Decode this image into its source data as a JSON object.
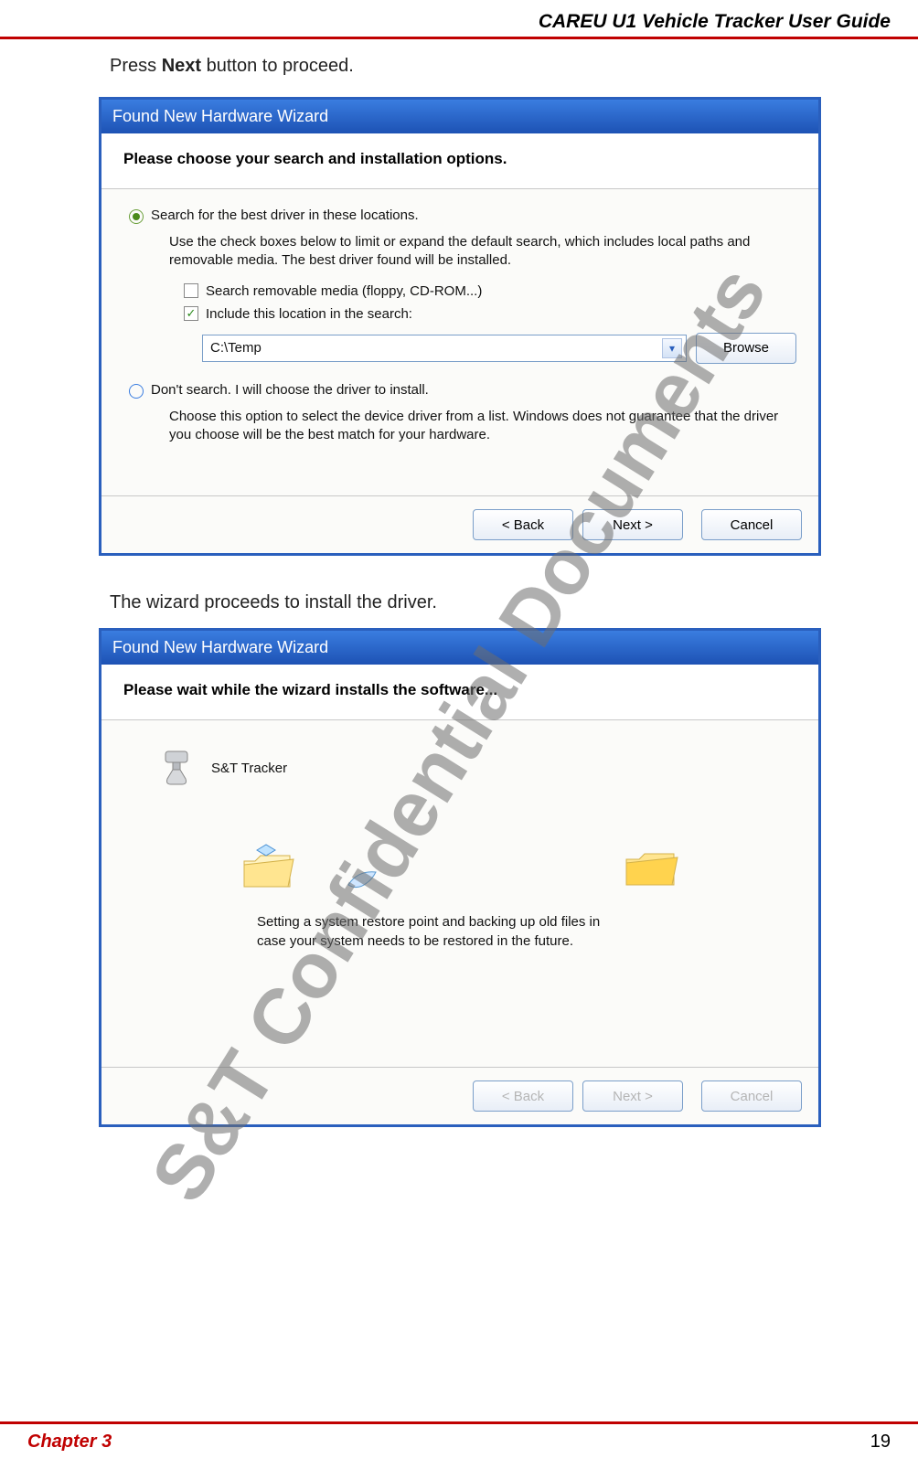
{
  "doc": {
    "header_title": "CAREU U1 Vehicle Tracker User Guide",
    "instruction_prefix": "Press ",
    "instruction_bold": "Next",
    "instruction_suffix": " button to proceed.",
    "instruction2": "The wizard proceeds to install the driver.",
    "chapter": "Chapter 3",
    "page": "19",
    "watermark": "S&T Confidential Documents"
  },
  "wizard1": {
    "title": "Found New Hardware Wizard",
    "subtitle": "Please choose your search and installation options.",
    "opt1_label": "Search for the best driver in these locations.",
    "opt1_explain": "Use the check boxes below to limit or expand the default search, which includes local paths and removable media. The best driver found will be installed.",
    "cb1_label": "Search removable media (floppy, CD-ROM...)",
    "cb2_label": "Include this location in the search:",
    "path_value": "C:\\Temp",
    "browse": "Browse",
    "opt2_label": "Don't search. I will choose the driver to install.",
    "opt2_explain": "Choose this option to select the device driver from a list.  Windows does not guarantee that the driver you choose will be the best match for your hardware.",
    "back": "< Back",
    "next": "Next >",
    "cancel": "Cancel"
  },
  "wizard2": {
    "title": "Found New Hardware Wizard",
    "subtitle": "Please wait while the wizard installs the software...",
    "device_name": "S&T Tracker",
    "progress_text": "Setting a system restore point and backing up old files in case your system needs to be restored in the future.",
    "back": "< Back",
    "next": "Next >",
    "cancel": "Cancel"
  }
}
